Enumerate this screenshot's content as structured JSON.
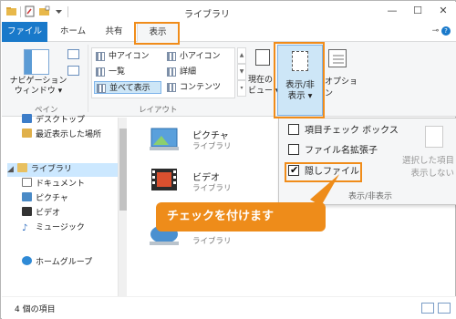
{
  "window": {
    "title": "ライブラリ"
  },
  "window_buttons": {
    "minimize": "—",
    "maximize": "☐",
    "close": "✕"
  },
  "tabs": {
    "file": "ファイル",
    "home": "ホーム",
    "share": "共有",
    "view": "表示"
  },
  "ribbon": {
    "navpane_label_1": "ナビゲーション",
    "navpane_label_2": "ウィンドウ ▾",
    "pane_group": "ペイン",
    "layout_items": [
      "中アイコン",
      "一覧",
      "並べて表示",
      "小アイコン",
      "詳細",
      "コンテンツ"
    ],
    "layout_group": "レイアウト",
    "current_view_1": "現在の",
    "current_view_2": "ビュー ▾",
    "showhide_1": "表示/非",
    "showhide_2": "表示 ▾",
    "options": "オプション"
  },
  "nav": {
    "items": [
      "デスクトップ",
      "最近表示した場所",
      "ライブラリ",
      "ドキュメント",
      "ピクチャ",
      "ビデオ",
      "ミュージック",
      "ホームグループ"
    ]
  },
  "content": {
    "items": [
      {
        "name": "ピクチャ",
        "sub": "ライブラリ"
      },
      {
        "name": "ビデオ",
        "sub": "ライブラリ"
      },
      {
        "name": "",
        "sub": "ライブラリ"
      }
    ]
  },
  "dropdown": {
    "item_checkboxes": "項目チェック ボックス",
    "file_extensions": "ファイル名拡張子",
    "hidden_items": "隠しファイル",
    "hide_selected_1": "選択した項目",
    "hide_selected_2": "表示しない",
    "group_label": "表示/非表示",
    "states": {
      "item_checkboxes": false,
      "file_extensions": false,
      "hidden_items": true
    }
  },
  "callout": {
    "text": "チェックを付けます"
  },
  "status": {
    "count": "4 個の項目"
  },
  "colors": {
    "accent": "#1979ca",
    "highlight": "#f08c1a",
    "callout": "#ee8c1a",
    "selected": "#cde6f7"
  }
}
